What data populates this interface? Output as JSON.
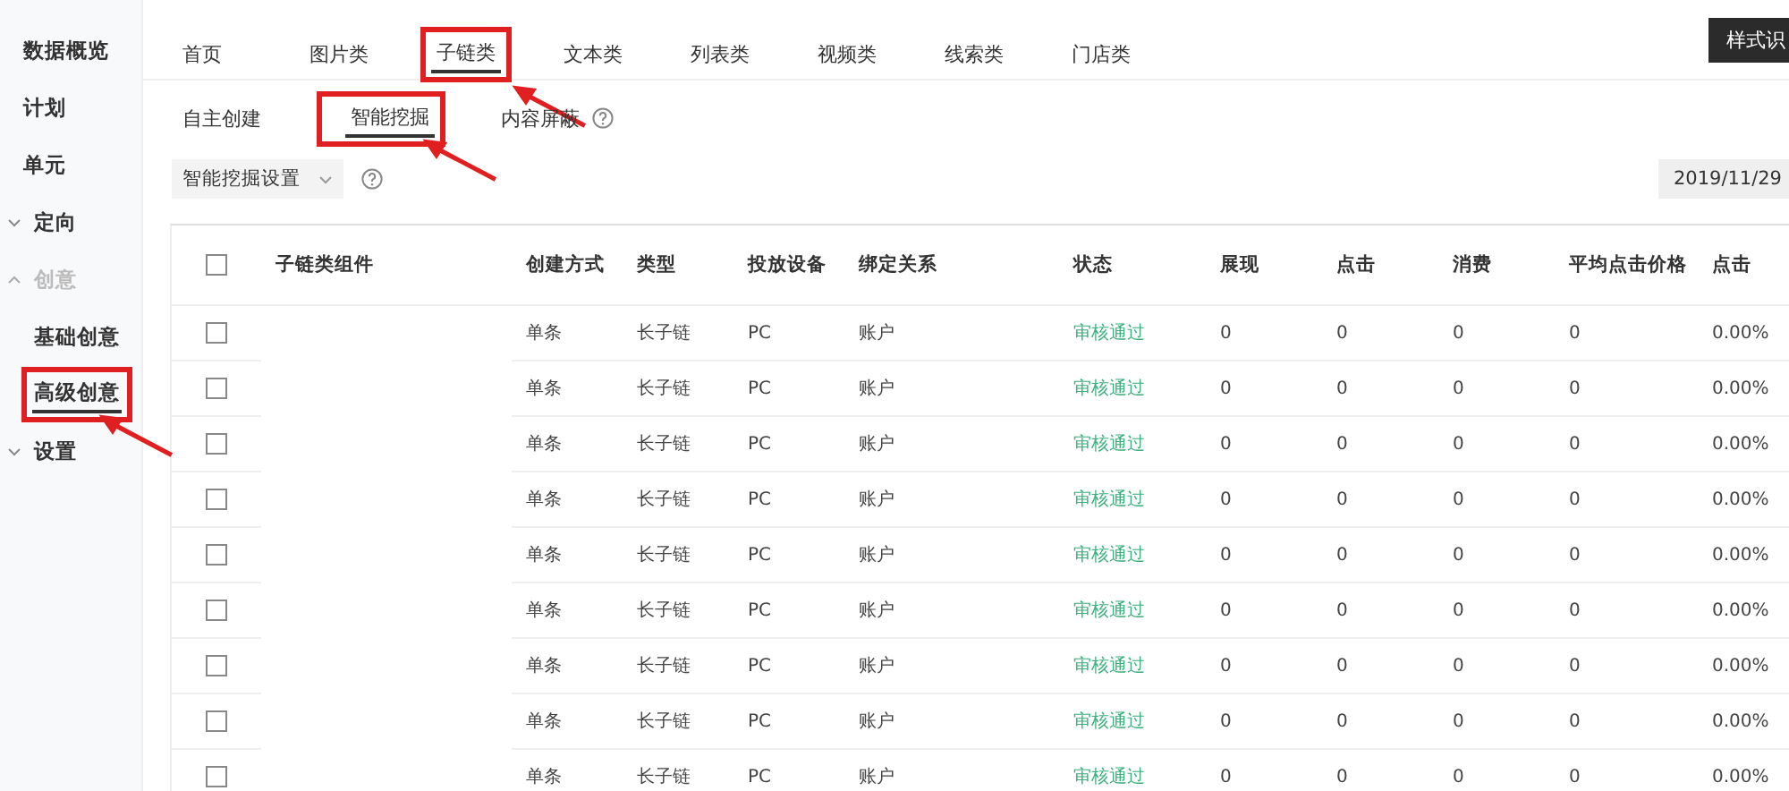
{
  "sidebar": {
    "items": [
      {
        "label": "数据概览",
        "selected": false,
        "highlighted": false
      },
      {
        "label": "计划",
        "selected": false,
        "highlighted": false
      },
      {
        "label": "单元",
        "selected": false,
        "highlighted": false
      },
      {
        "label": "定向",
        "expanded": false,
        "selected": false,
        "highlighted": false
      },
      {
        "label": "创意",
        "expanded": true,
        "selected": false,
        "highlighted": false,
        "children": [
          {
            "label": "基础创意",
            "selected": false,
            "highlighted": false
          },
          {
            "label": "高级创意",
            "selected": true,
            "highlighted": true
          }
        ]
      },
      {
        "label": "设置",
        "expanded": false,
        "selected": false,
        "highlighted": false
      }
    ]
  },
  "tabs": [
    {
      "label": "首页",
      "selected": false,
      "highlighted": false
    },
    {
      "label": "图片类",
      "selected": false,
      "highlighted": false
    },
    {
      "label": "子链类",
      "selected": true,
      "highlighted": true
    },
    {
      "label": "文本类",
      "selected": false,
      "highlighted": false
    },
    {
      "label": "列表类",
      "selected": false,
      "highlighted": false
    },
    {
      "label": "视频类",
      "selected": false,
      "highlighted": false
    },
    {
      "label": "线索类",
      "selected": false,
      "highlighted": false
    },
    {
      "label": "门店类",
      "selected": false,
      "highlighted": false
    }
  ],
  "top_button": "样式识",
  "subtabs": [
    {
      "label": "自主创建",
      "selected": false,
      "highlighted": false,
      "help": false
    },
    {
      "label": "智能挖掘",
      "selected": true,
      "highlighted": true,
      "help": false
    },
    {
      "label": "内容屏蔽",
      "selected": false,
      "highlighted": false,
      "help": true
    }
  ],
  "dropdown": {
    "value": "智能挖掘设置"
  },
  "date": "2019/11/29",
  "table": {
    "columns": [
      "子链类组件",
      "创建方式",
      "类型",
      "投放设备",
      "绑定关系",
      "状态",
      "展现",
      "点击",
      "消费",
      "平均点击价格",
      "点击"
    ],
    "header_checked": false,
    "rows": [
      {
        "checked": false,
        "cells": [
          "",
          "单条",
          "长子链",
          "PC",
          "账户",
          "审核通过",
          "0",
          "0",
          "0",
          "0",
          "0.00%"
        ]
      },
      {
        "checked": false,
        "cells": [
          "",
          "单条",
          "长子链",
          "PC",
          "账户",
          "审核通过",
          "0",
          "0",
          "0",
          "0",
          "0.00%"
        ]
      },
      {
        "checked": false,
        "cells": [
          "",
          "单条",
          "长子链",
          "PC",
          "账户",
          "审核通过",
          "0",
          "0",
          "0",
          "0",
          "0.00%"
        ]
      },
      {
        "checked": false,
        "cells": [
          "",
          "单条",
          "长子链",
          "PC",
          "账户",
          "审核通过",
          "0",
          "0",
          "0",
          "0",
          "0.00%"
        ]
      },
      {
        "checked": false,
        "cells": [
          "",
          "单条",
          "长子链",
          "PC",
          "账户",
          "审核通过",
          "0",
          "0",
          "0",
          "0",
          "0.00%"
        ]
      },
      {
        "checked": false,
        "cells": [
          "",
          "单条",
          "长子链",
          "PC",
          "账户",
          "审核通过",
          "0",
          "0",
          "0",
          "0",
          "0.00%"
        ]
      },
      {
        "checked": false,
        "cells": [
          "",
          "单条",
          "长子链",
          "PC",
          "账户",
          "审核通过",
          "0",
          "0",
          "0",
          "0",
          "0.00%"
        ]
      },
      {
        "checked": false,
        "cells": [
          "",
          "单条",
          "长子链",
          "PC",
          "账户",
          "审核通过",
          "0",
          "0",
          "0",
          "0",
          "0.00%"
        ]
      },
      {
        "checked": false,
        "cells": [
          "",
          "单条",
          "长子链",
          "PC",
          "账户",
          "审核通过",
          "0",
          "0",
          "0",
          "0",
          "0.00%"
        ]
      }
    ]
  }
}
